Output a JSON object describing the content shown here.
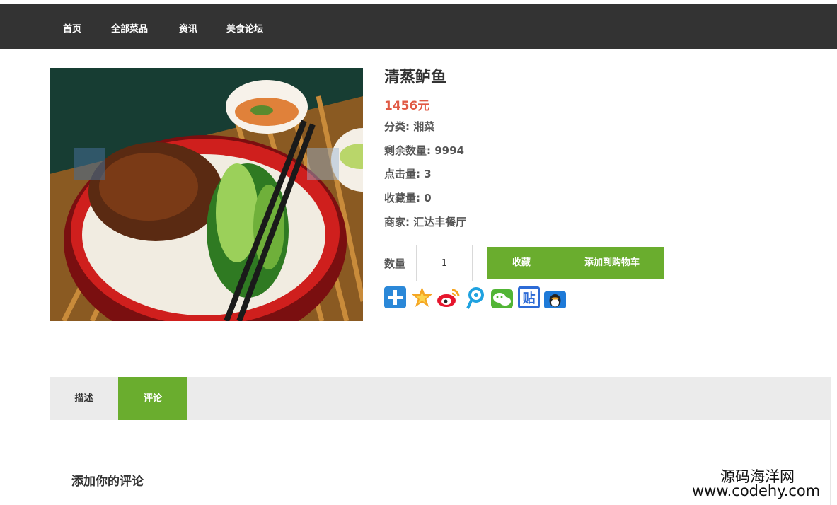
{
  "nav": {
    "items": [
      {
        "label": "首页"
      },
      {
        "label": "全部菜品"
      },
      {
        "label": "资讯"
      },
      {
        "label": "美食论坛"
      }
    ]
  },
  "product": {
    "title": "清蒸鲈鱼",
    "price": "1456元",
    "info": [
      {
        "label": "分类: ",
        "value": "湘菜"
      },
      {
        "label": "剩余数量: ",
        "value": "9994"
      },
      {
        "label": "点击量: ",
        "value": "3"
      },
      {
        "label": "收藏量: ",
        "value": "0"
      },
      {
        "label": "商家: ",
        "value": "汇达丰餐厅"
      }
    ],
    "image_alt": "dish photo",
    "quantity_label": "数量",
    "quantity_value": "1",
    "favorite_label": "收藏",
    "add_to_cart_label": "添加到购物车"
  },
  "share": [
    {
      "icon": "plus-share-icon",
      "color": "#2b88d8"
    },
    {
      "icon": "qzone-icon",
      "color": "#f5a623"
    },
    {
      "icon": "weibo-icon",
      "color": "#e6162d"
    },
    {
      "icon": "tencent-weibo-icon",
      "color": "#1fa2e0"
    },
    {
      "icon": "wechat-icon",
      "color": "#51b535"
    },
    {
      "icon": "tieba-icon",
      "color": "#2d6bd6"
    },
    {
      "icon": "qq-icon",
      "color": "#1e7ad8"
    }
  ],
  "tabs": [
    {
      "label": "描述"
    },
    {
      "label": "评论"
    }
  ],
  "review": {
    "heading": "添加你的评论"
  },
  "watermark": {
    "name": "源码海洋网",
    "url": "www.codehy.com"
  },
  "colors": {
    "nav_bg": "#333333",
    "accent_green": "#6aad2e",
    "price_red": "#e05a45"
  }
}
